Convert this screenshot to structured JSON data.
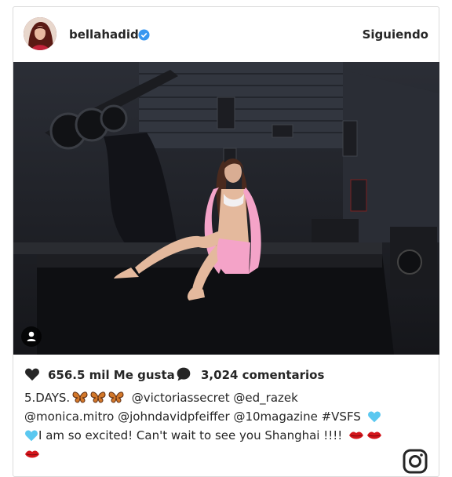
{
  "post": {
    "username": "bellahadid",
    "follow_state": "Siguiendo",
    "likes": "656.5 mil Me gusta",
    "comments": "3,024 comentarios",
    "caption": {
      "part1": "5.DAYS.",
      "part2": "@victoriassecret @ed_razek",
      "part3": "@monica.mitro @johndavidpfeiffer @10magazine #VSFS",
      "part4": "I am so excited! Can't wait to see you Shanghai !!!!"
    }
  },
  "colors": {
    "verified": "#3897f0",
    "text": "#262626",
    "border": "#dbdbdb",
    "heart_emoji": "#5bc8f0",
    "lips_emoji": "#d4161c",
    "butterfly_emoji": "#d3782a"
  },
  "icons": [
    "verified-badge-icon",
    "user-tag-icon",
    "heart-icon",
    "comment-icon",
    "butterfly-emoji",
    "blue-heart-emoji",
    "lips-emoji",
    "camera-icon"
  ]
}
